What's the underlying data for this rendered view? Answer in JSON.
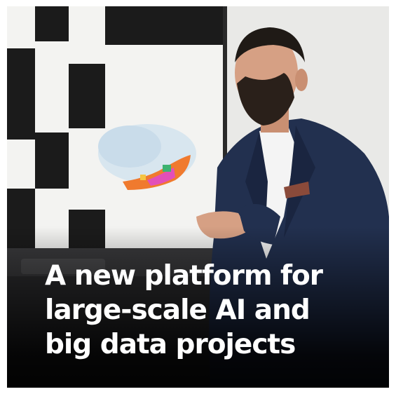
{
  "headline": {
    "line1": "A new platform for",
    "line2": "large-scale AI and",
    "line3": "big data projects"
  },
  "colors": {
    "screen": "#f2f2f0",
    "suit": "#22304f",
    "shirt": "#f4f4f4",
    "headline_text": "#ffffff"
  }
}
